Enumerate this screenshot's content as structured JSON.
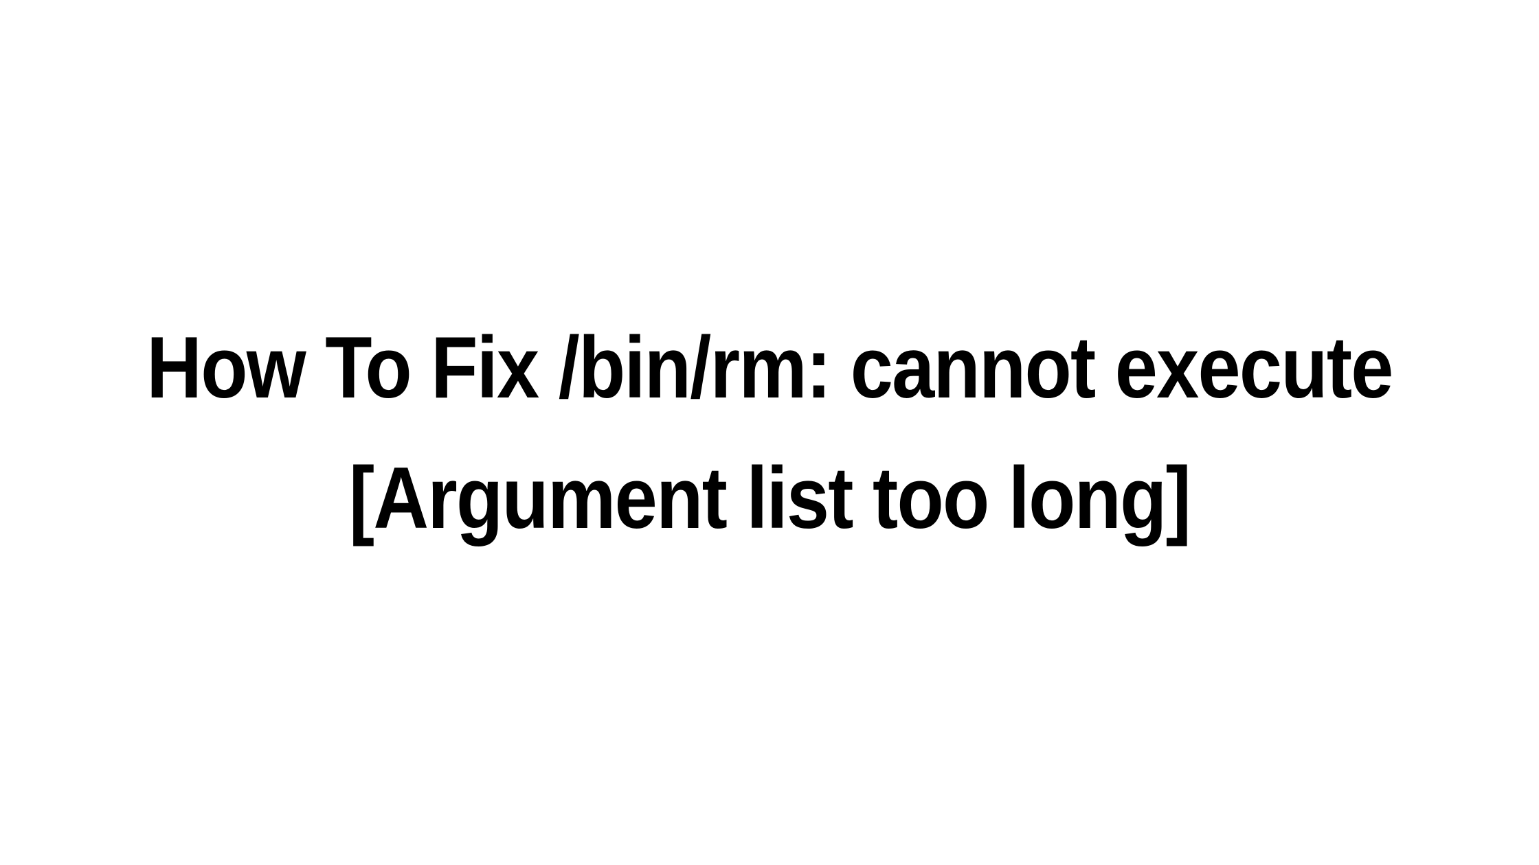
{
  "title": {
    "line1": "How To Fix /bin/rm: cannot execute",
    "line2": "[Argument list too long]"
  }
}
